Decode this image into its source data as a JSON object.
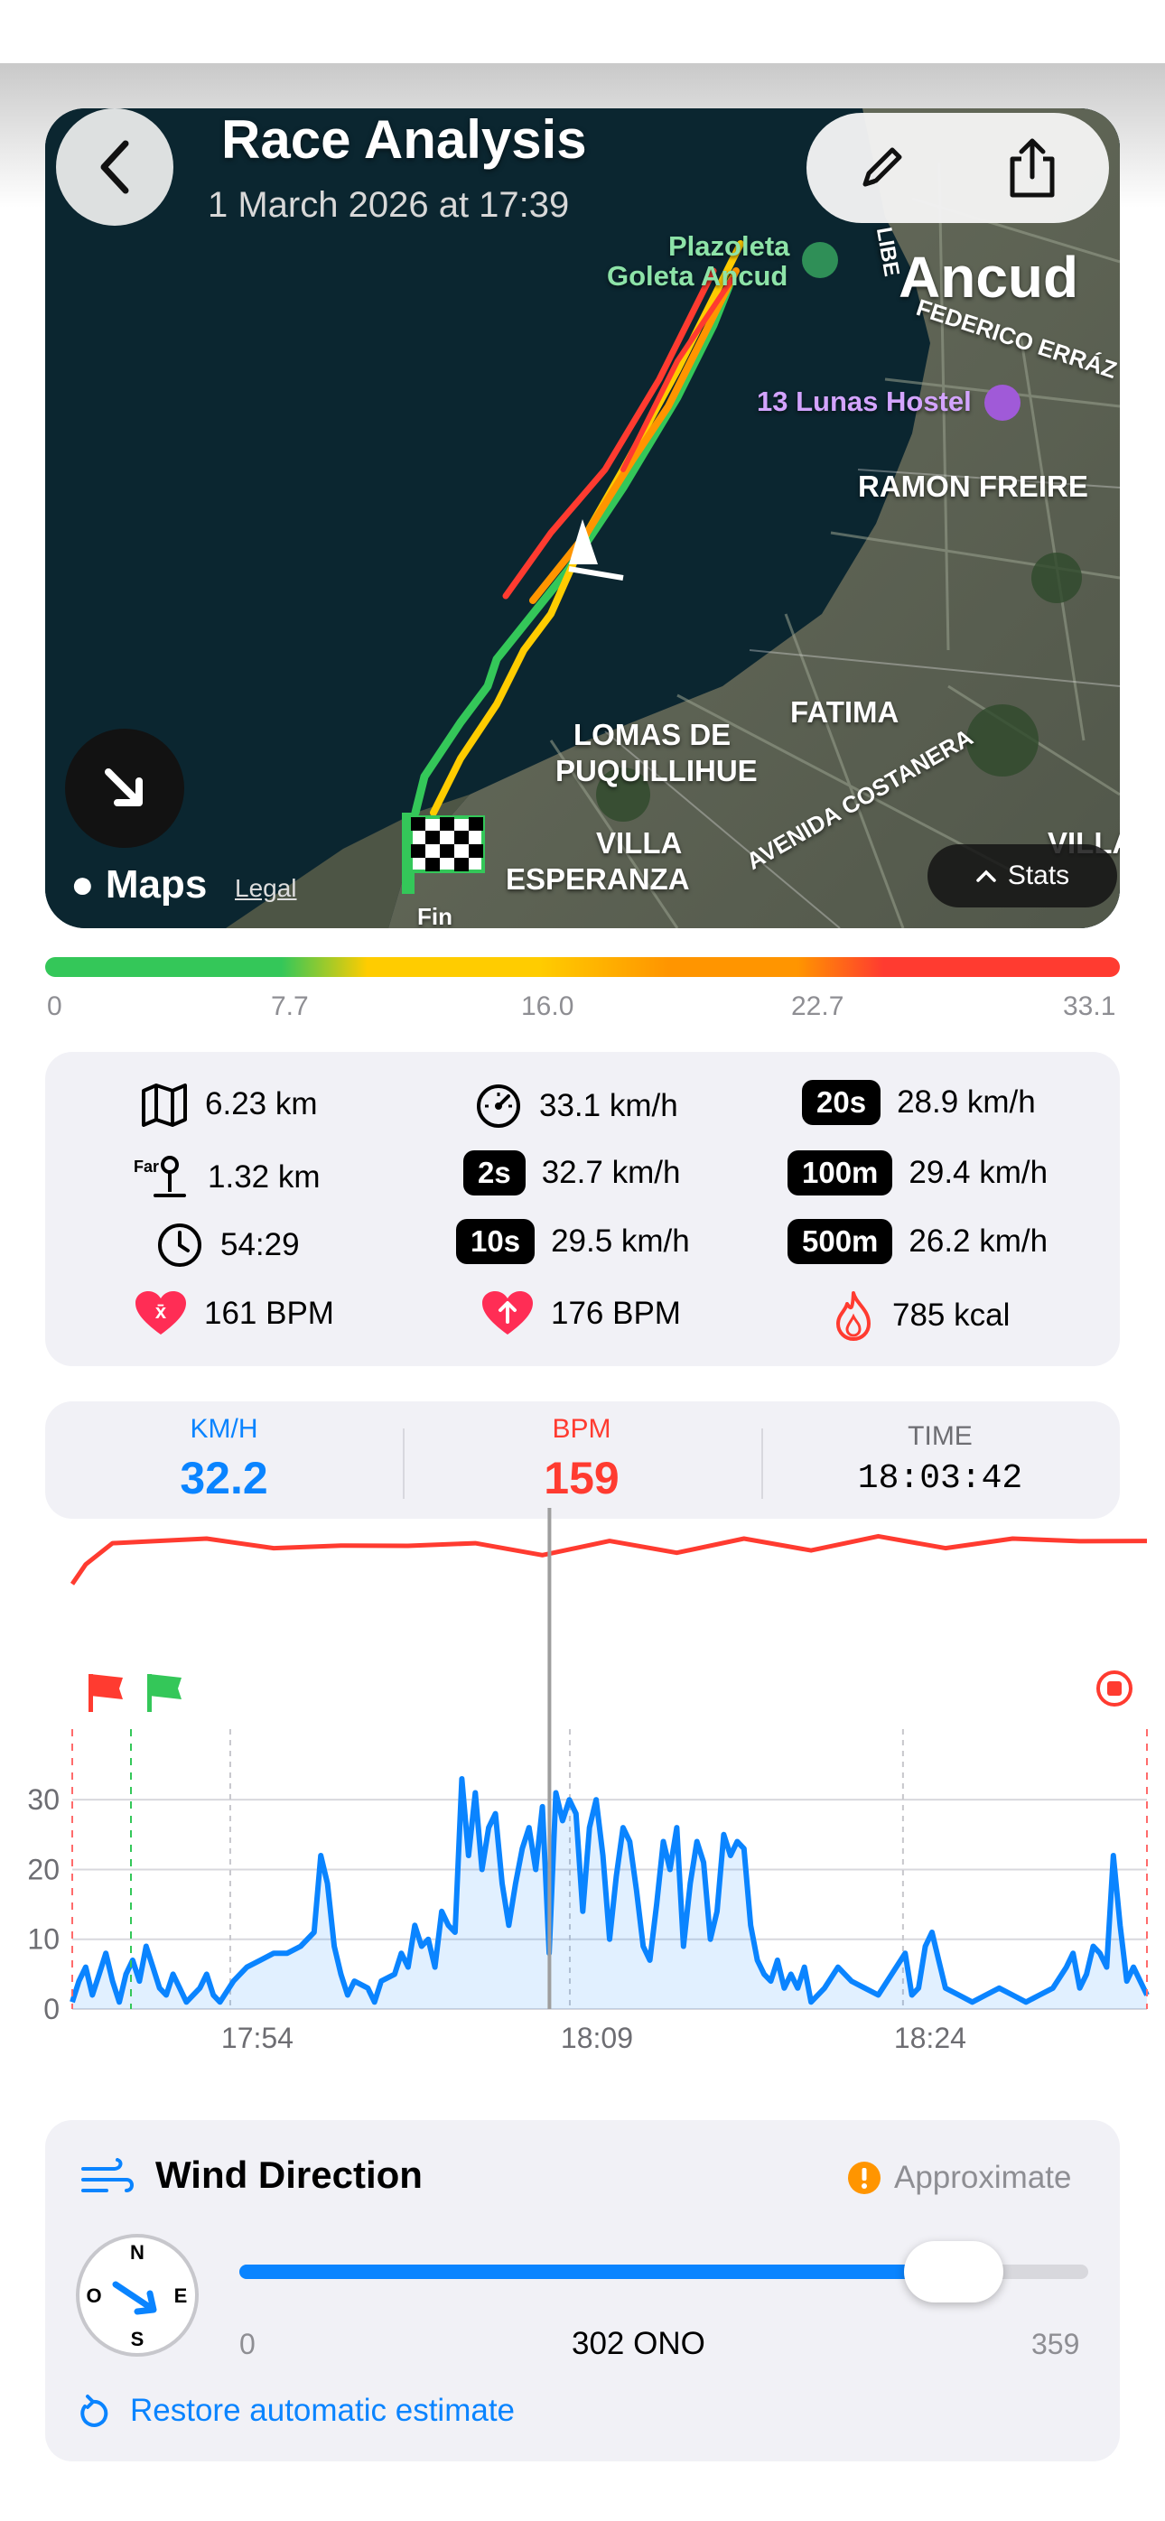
{
  "header": {
    "title": "Race Analysis",
    "subtitle": "1 March 2026 at 17:39",
    "back_icon": "chevron-left-icon",
    "edit_icon": "pencil-icon",
    "share_icon": "share-icon"
  },
  "map": {
    "labels": {
      "plazoleta": "Plazoleta",
      "goleta": "Goleta Ancud",
      "ancud": "Ancud",
      "federico": "FEDERICO ERRÁZ",
      "hostel": "13 Lunas Hostel",
      "ramon": "RAMON FREIRE",
      "fatima": "FATIMA",
      "lomas1": "LOMAS DE",
      "lomas2": "PUQUILLIHUE",
      "villa1": "VILLA",
      "villa2": "ESPERANZA",
      "avenida": "AVENIDA COSTANERA",
      "libertad": "LIBE",
      "villa_right": "VILLA",
      "fin": "Fin"
    },
    "maps_label": "Maps",
    "legal_label": "Legal",
    "stats_label": "Stats",
    "locate_icon": "arrow-down-right-icon"
  },
  "speed_scale": {
    "ticks": [
      "0",
      "7.7",
      "16.0",
      "22.7",
      "33.1"
    ],
    "colors": {
      "green": "#34c759",
      "yellow": "#ffcc00",
      "orange": "#ff9500",
      "red": "#ff3b30"
    }
  },
  "stats": {
    "distance": "6.23 km",
    "max_speed": "33.1 km/h",
    "tag_20s": "20s",
    "speed_20s": "28.9 km/h",
    "far": "1.32 km",
    "far_icon_text": "Far",
    "tag_2s": "2s",
    "speed_2s": "32.7 km/h",
    "tag_100m": "100m",
    "speed_100m": "29.4 km/h",
    "duration": "54:29",
    "tag_10s": "10s",
    "speed_10s": "29.5 km/h",
    "tag_500m": "500m",
    "speed_500m": "26.2 km/h",
    "avg_hr": "161 BPM",
    "max_hr": "176 BPM",
    "calories": "785 kcal"
  },
  "readout": {
    "speed_label": "KM/H",
    "speed_value": "32.2",
    "hr_label": "BPM",
    "hr_value": "159",
    "time_label": "TIME",
    "time_value": "18:03:42"
  },
  "chart_data": {
    "type": "line",
    "x_ticks": [
      "17:54",
      "18:09",
      "18:24"
    ],
    "y_ticks": [
      0,
      10,
      20,
      30
    ],
    "ylim": [
      0,
      33
    ],
    "xlim_minutes": [
      0,
      54.5
    ],
    "cursor_minute": 24.2,
    "series": [
      {
        "name": "KM/H",
        "color": "#0a84ff",
        "points": [
          [
            0,
            1
          ],
          [
            0.5,
            4
          ],
          [
            1,
            6
          ],
          [
            1.5,
            2
          ],
          [
            2,
            5
          ],
          [
            2.5,
            8
          ],
          [
            3,
            4
          ],
          [
            3.5,
            1
          ],
          [
            4,
            5
          ],
          [
            4.5,
            7
          ],
          [
            5,
            4
          ],
          [
            5.5,
            9
          ],
          [
            6,
            6
          ],
          [
            6.5,
            3
          ],
          [
            7,
            2
          ],
          [
            7.5,
            5
          ],
          [
            8,
            3
          ],
          [
            8.5,
            1
          ],
          [
            9,
            2
          ],
          [
            9.5,
            3
          ],
          [
            10,
            5
          ],
          [
            10.5,
            2
          ],
          [
            11,
            1
          ],
          [
            12,
            4
          ],
          [
            13,
            6
          ],
          [
            14,
            7
          ],
          [
            15,
            8
          ],
          [
            16,
            8
          ],
          [
            17,
            9
          ],
          [
            18,
            11
          ],
          [
            18.5,
            22
          ],
          [
            19,
            18
          ],
          [
            19.5,
            9
          ],
          [
            20,
            5
          ],
          [
            20.5,
            2
          ],
          [
            21,
            4
          ],
          [
            22,
            3
          ],
          [
            22.5,
            1
          ],
          [
            23,
            4
          ],
          [
            24,
            5
          ],
          [
            24.5,
            8
          ],
          [
            25,
            6
          ],
          [
            25.5,
            12
          ],
          [
            26,
            9
          ],
          [
            26.5,
            10
          ],
          [
            27,
            6
          ],
          [
            27.5,
            14
          ],
          [
            28,
            12
          ],
          [
            28.5,
            11
          ],
          [
            29,
            33
          ],
          [
            29.5,
            22
          ],
          [
            30,
            31
          ],
          [
            30.5,
            20
          ],
          [
            31,
            26
          ],
          [
            31.5,
            28
          ],
          [
            32,
            18
          ],
          [
            32.5,
            12
          ],
          [
            33,
            18
          ],
          [
            33.5,
            23
          ],
          [
            34,
            26
          ],
          [
            34.5,
            20
          ],
          [
            35,
            29
          ],
          [
            35.5,
            8
          ],
          [
            36,
            31
          ],
          [
            36.5,
            27
          ],
          [
            37,
            30
          ],
          [
            37.5,
            28
          ],
          [
            38,
            14
          ],
          [
            38.5,
            26
          ],
          [
            39,
            30
          ],
          [
            39.5,
            22
          ],
          [
            40,
            10
          ],
          [
            40.5,
            19
          ],
          [
            41,
            26
          ],
          [
            41.5,
            24
          ],
          [
            42,
            17
          ],
          [
            42.5,
            9
          ],
          [
            43,
            7
          ],
          [
            43.5,
            15
          ],
          [
            44,
            24
          ],
          [
            44.5,
            20
          ],
          [
            45,
            26
          ],
          [
            45.5,
            9
          ],
          [
            46,
            18
          ],
          [
            46.5,
            24
          ],
          [
            47,
            21
          ],
          [
            47.5,
            10
          ],
          [
            48,
            14
          ],
          [
            48.5,
            25
          ],
          [
            49,
            22
          ],
          [
            49.5,
            24
          ],
          [
            50,
            23
          ],
          [
            50.5,
            12
          ],
          [
            51,
            7
          ],
          [
            51.5,
            5
          ],
          [
            52,
            4
          ],
          [
            52.5,
            7
          ],
          [
            53,
            3
          ],
          [
            53.5,
            5
          ],
          [
            54,
            3
          ],
          [
            54.5,
            6
          ],
          [
            55,
            1
          ],
          [
            56,
            3
          ],
          [
            57,
            6
          ],
          [
            58,
            4
          ],
          [
            59,
            3
          ],
          [
            60,
            2
          ],
          [
            61,
            5
          ],
          [
            62,
            8
          ],
          [
            62.5,
            2
          ],
          [
            63,
            3
          ],
          [
            63.5,
            9
          ],
          [
            64,
            11
          ],
          [
            64.5,
            7
          ],
          [
            65,
            3
          ],
          [
            66,
            2
          ],
          [
            67,
            1
          ],
          [
            68,
            2
          ],
          [
            69,
            3
          ],
          [
            70,
            2
          ],
          [
            71,
            1
          ],
          [
            72,
            2
          ],
          [
            73,
            3
          ],
          [
            74,
            6
          ],
          [
            74.5,
            8
          ],
          [
            75,
            3
          ],
          [
            75.5,
            5
          ],
          [
            76,
            9
          ],
          [
            76.5,
            8
          ],
          [
            77,
            6
          ],
          [
            77.5,
            22
          ],
          [
            78,
            12
          ],
          [
            78.5,
            4
          ],
          [
            79,
            6
          ],
          [
            80,
            2
          ]
        ]
      },
      {
        "name": "BPM",
        "color": "#ff3b30",
        "points": [
          [
            0,
            140
          ],
          [
            1,
            150
          ],
          [
            3,
            156
          ],
          [
            6,
            160
          ],
          [
            10,
            158
          ],
          [
            15,
            157
          ],
          [
            20,
            155
          ],
          [
            25,
            158
          ],
          [
            30,
            156
          ],
          [
            35,
            154
          ],
          [
            40,
            157
          ],
          [
            45,
            155
          ],
          [
            50,
            158
          ],
          [
            55,
            156
          ],
          [
            60,
            159
          ],
          [
            65,
            157
          ],
          [
            70,
            158
          ],
          [
            75,
            160
          ],
          [
            80,
            157
          ]
        ]
      }
    ]
  },
  "chart_icons": {
    "start_flag_red": "red-flag-icon",
    "start_flag_green": "green-flag-icon",
    "stop": "stop-circle-icon"
  },
  "wind": {
    "title": "Wind Direction",
    "approx_label": "Approximate",
    "compass": {
      "n": "N",
      "e": "E",
      "s": "S",
      "o": "O"
    },
    "slider_min": "0",
    "slider_max": "359",
    "slider_value": 302,
    "slider_value_label": "302 ONO",
    "restore_label": "Restore automatic estimate"
  }
}
